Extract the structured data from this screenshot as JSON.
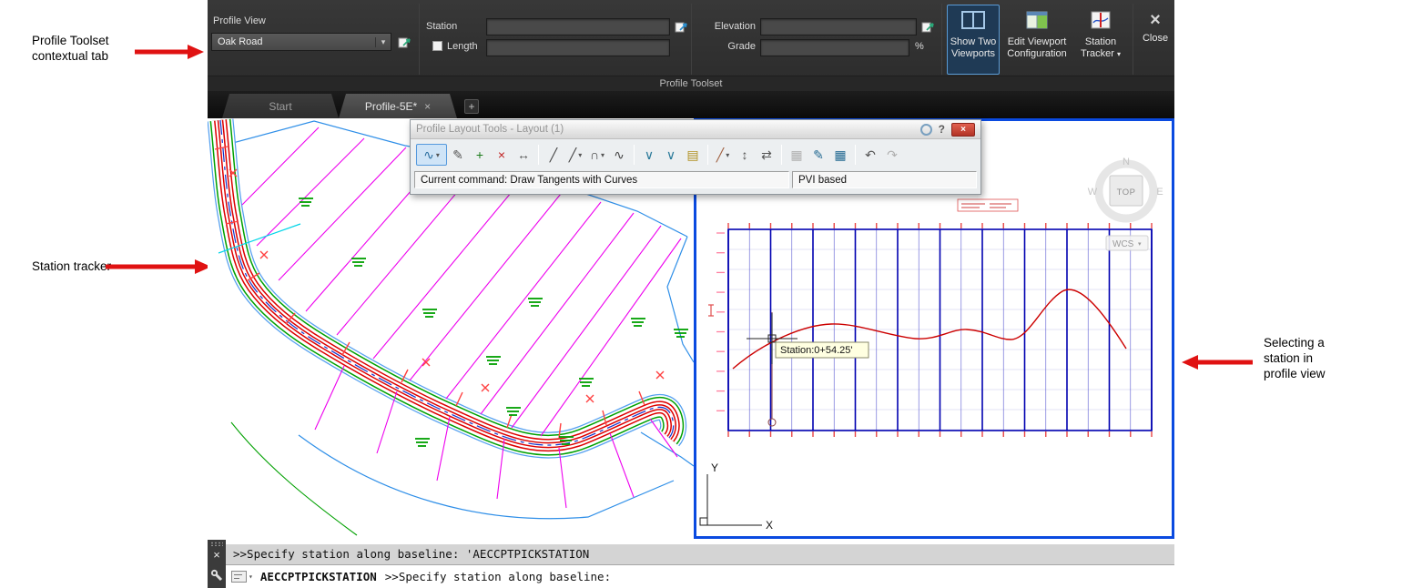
{
  "annotations": {
    "profile_toolset": "Profile Toolset contextual tab",
    "station_tracker": "Station tracker",
    "selecting_station": "Selecting a station in profile view"
  },
  "icons": {
    "dropdown": "▾",
    "close": "×",
    "plus": "+",
    "help": "?"
  },
  "ribbon": {
    "profile_view_label": "Profile View",
    "profile_view_value": "Oak Road",
    "station_label": "Station",
    "length_label": "Length",
    "elevation_label": "Elevation",
    "grade_label": "Grade",
    "percent": "%",
    "show_two_viewports": "Show Two Viewports",
    "edit_viewport_config": "Edit Viewport Configuration",
    "station_tracker": "Station Tracker",
    "close_label": "Close",
    "panel_label": "Profile Toolset"
  },
  "tabs": {
    "start": "Start",
    "active": "Profile-5E*"
  },
  "palette": {
    "title": "Profile Layout Tools - Layout (1)",
    "status_command": "Current command: Draw Tangents with Curves",
    "status_mode": "PVI based",
    "tools": [
      {
        "name": "draw-tangents-with-curves",
        "glyph": "∿",
        "dd": true,
        "sel": true,
        "color": "#2a6ea0"
      },
      {
        "name": "insert-pvis-tabular",
        "glyph": "✎",
        "color": "#555"
      },
      {
        "name": "insert-pvi",
        "glyph": "+",
        "color": "#1a7a1a"
      },
      {
        "name": "delete-pvi",
        "glyph": "×",
        "color": "#c02020"
      },
      {
        "name": "move-pvi",
        "glyph": "↔",
        "color": "#555"
      },
      {
        "sep": true
      },
      {
        "name": "fixed-tangent-two-points",
        "glyph": "╱",
        "color": "#444"
      },
      {
        "name": "float-tangent",
        "glyph": "╱",
        "dd": true,
        "color": "#444"
      },
      {
        "name": "fixed-curve",
        "glyph": "∩",
        "dd": true,
        "color": "#444"
      },
      {
        "name": "free-curve-best-fit",
        "glyph": "∿",
        "color": "#444"
      },
      {
        "sep": true
      },
      {
        "name": "fixed-vertical-curve",
        "glyph": "∨",
        "color": "#2a7a9a"
      },
      {
        "name": "free-vertical-curve",
        "glyph": "∨",
        "color": "#2a7a9a"
      },
      {
        "name": "curve-from-file",
        "glyph": "▤",
        "color": "#b09020"
      },
      {
        "sep": true
      },
      {
        "name": "transparent-line",
        "glyph": "╱",
        "dd": true,
        "color": "#a06040"
      },
      {
        "name": "raise-lower-pvi",
        "glyph": "↕",
        "color": "#555"
      },
      {
        "name": "copy-profile",
        "glyph": "⇄",
        "color": "#555"
      },
      {
        "sep": true
      },
      {
        "name": "profile-grid-view",
        "glyph": "▦",
        "disabled": true
      },
      {
        "name": "profile-layout-parameters",
        "glyph": "✎",
        "color": "#246a92"
      },
      {
        "name": "profile-settings-table",
        "glyph": "▦",
        "color": "#246a92"
      },
      {
        "sep": true
      },
      {
        "name": "undo",
        "glyph": "↶",
        "color": "#555"
      },
      {
        "name": "redo",
        "glyph": "↷",
        "disabled": true
      }
    ]
  },
  "profile_view": {
    "tooltip": "Station:0+54.25'",
    "wcs": "WCS",
    "viewcube_top": "TOP",
    "viewcube_n": "N",
    "viewcube_w": "W",
    "viewcube_e": "E",
    "ucs_x": "X",
    "ucs_y": "Y"
  },
  "command_line": {
    "history": ">>Specify station along baseline: 'AECCPTPICKSTATION",
    "command": "AECCPTPICKSTATION",
    "prompt": ">>Specify station along baseline:"
  }
}
